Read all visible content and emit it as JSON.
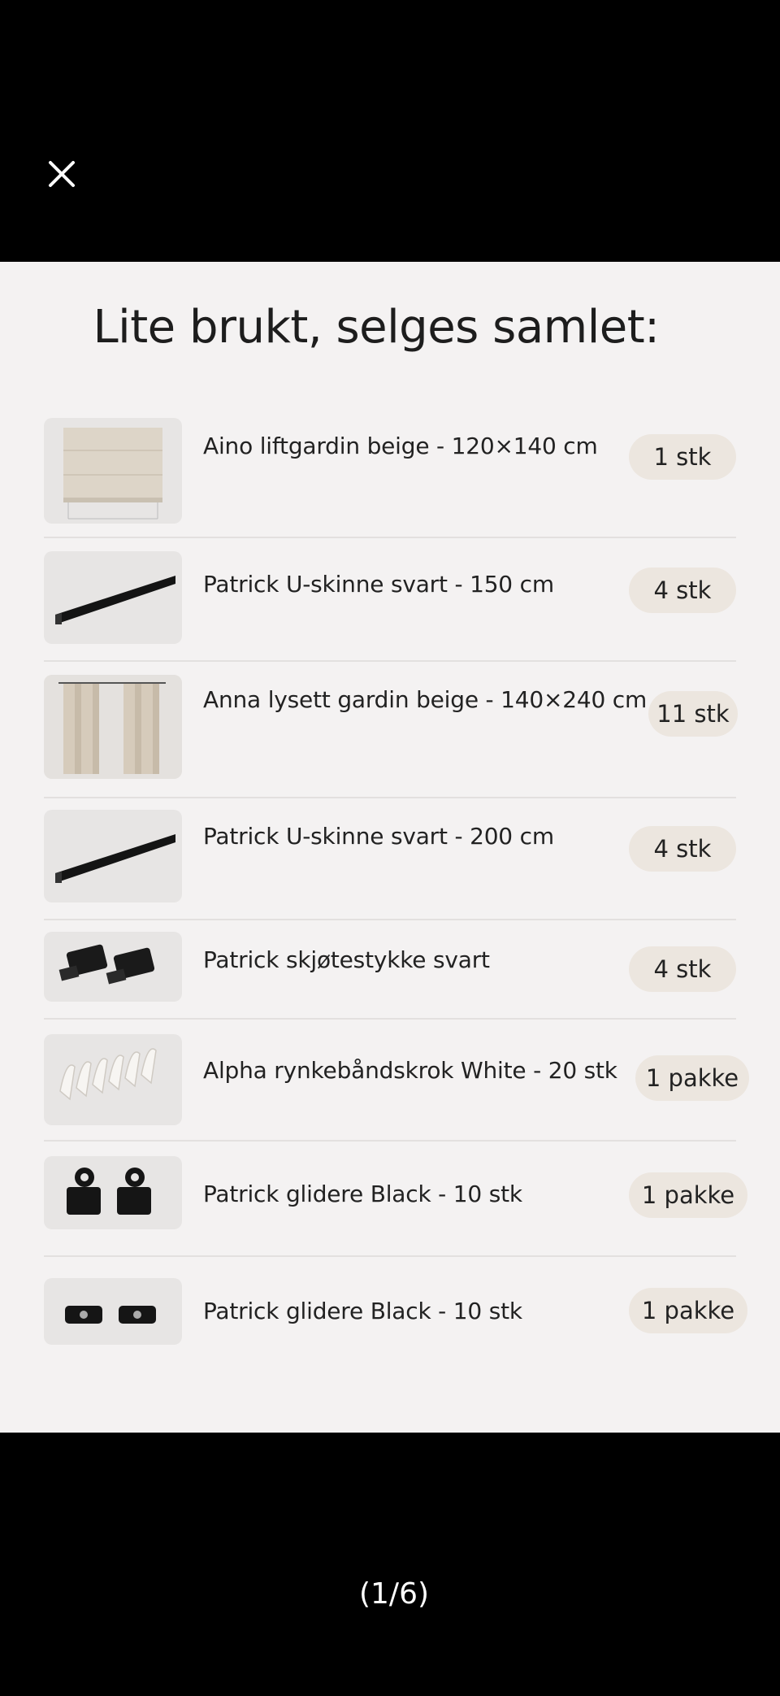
{
  "viewer": {
    "close_icon": "close-icon",
    "page_counter": "(1/6)"
  },
  "sheet": {
    "title": "Lite brukt, selges samlet:",
    "items": [
      {
        "name": "Aino liftgardin beige - 120×140 cm",
        "qty": "1 stk",
        "image": "roman-blind"
      },
      {
        "name": "Patrick U-skinne svart - 150 cm",
        "qty": "4 stk",
        "image": "black-rail"
      },
      {
        "name": "Anna lysett gardin beige - 140×240 cm",
        "qty": "11 stk",
        "image": "curtain"
      },
      {
        "name": "Patrick U-skinne svart - 200 cm",
        "qty": "4 stk",
        "image": "black-rail"
      },
      {
        "name": "Patrick skjøtestykke svart",
        "qty": "4 stk",
        "image": "rail-connector"
      },
      {
        "name": "Alpha rynkebåndskrok White - 20 stk",
        "qty": "1 pakke",
        "image": "white-hooks"
      },
      {
        "name": "Patrick glidere Black - 10 stk",
        "qty": "1 pakke",
        "image": "black-gliders"
      },
      {
        "name": "Patrick glidere Black - 10 stk",
        "qty": "1 pakke",
        "image": "black-gliders-flat"
      }
    ]
  }
}
